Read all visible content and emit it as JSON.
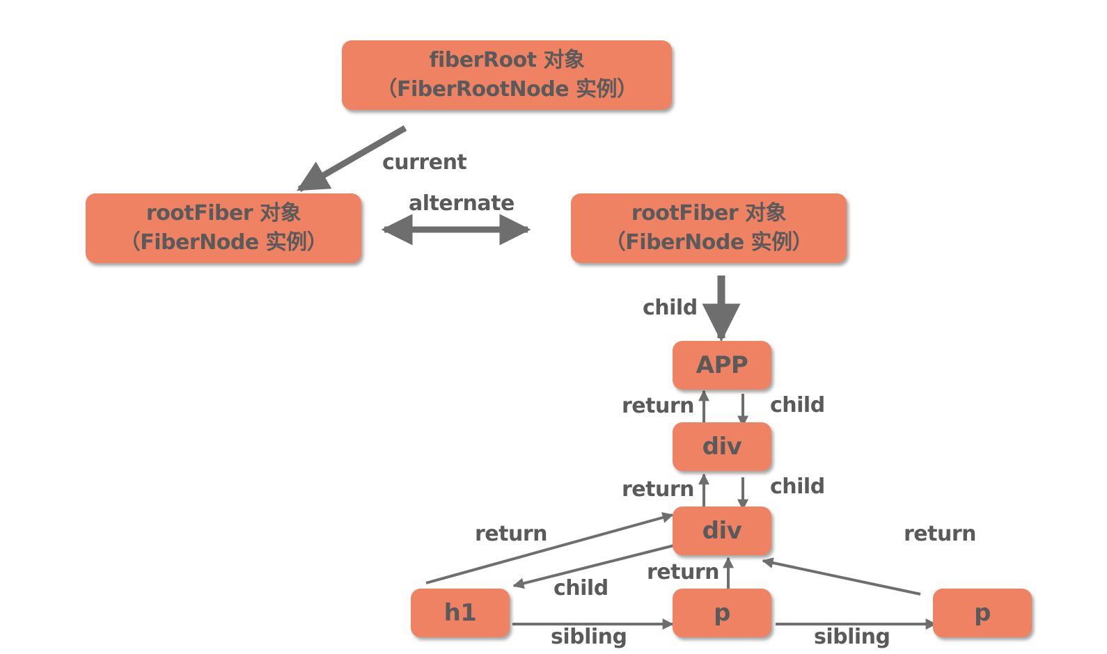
{
  "diagram": {
    "colors": {
      "node_fill": "#f08264",
      "text": "#5a5a5a",
      "edge": "#6e6e6e",
      "background": "#ffffff"
    },
    "nodes": [
      {
        "id": "fiberRoot",
        "lines": [
          "fiberRoot 对象",
          "（FiberRootNode 实例）"
        ]
      },
      {
        "id": "rootFiberCurrent",
        "lines": [
          "rootFiber 对象",
          "（FiberNode 实例）"
        ]
      },
      {
        "id": "rootFiberAlt",
        "lines": [
          "rootFiber 对象",
          "（FiberNode 实例）"
        ]
      },
      {
        "id": "app",
        "lines": [
          "APP"
        ]
      },
      {
        "id": "div1",
        "lines": [
          "div"
        ]
      },
      {
        "id": "div2",
        "lines": [
          "div"
        ]
      },
      {
        "id": "h1",
        "lines": [
          "h1"
        ]
      },
      {
        "id": "p1",
        "lines": [
          "p"
        ]
      },
      {
        "id": "p2",
        "lines": [
          "p"
        ]
      }
    ],
    "edges": [
      {
        "from": "fiberRoot",
        "to": "rootFiberCurrent",
        "label": "current"
      },
      {
        "from": "rootFiberCurrent",
        "to": "rootFiberAlt",
        "label": "alternate",
        "bidirectional": true
      },
      {
        "from": "rootFiberAlt",
        "to": "app",
        "label": "child"
      },
      {
        "from": "app",
        "to": "div1",
        "label": "child"
      },
      {
        "from": "div1",
        "to": "app",
        "label": "return"
      },
      {
        "from": "div1",
        "to": "div2",
        "label": "child"
      },
      {
        "from": "div2",
        "to": "div1",
        "label": "return"
      },
      {
        "from": "div2",
        "to": "h1",
        "label": "child"
      },
      {
        "from": "h1",
        "to": "div2",
        "label": "return"
      },
      {
        "from": "h1",
        "to": "p1",
        "label": "sibling"
      },
      {
        "from": "p1",
        "to": "div2",
        "label": "return"
      },
      {
        "from": "p1",
        "to": "p2",
        "label": "sibling"
      },
      {
        "from": "p2",
        "to": "div2",
        "label": "return"
      }
    ]
  }
}
